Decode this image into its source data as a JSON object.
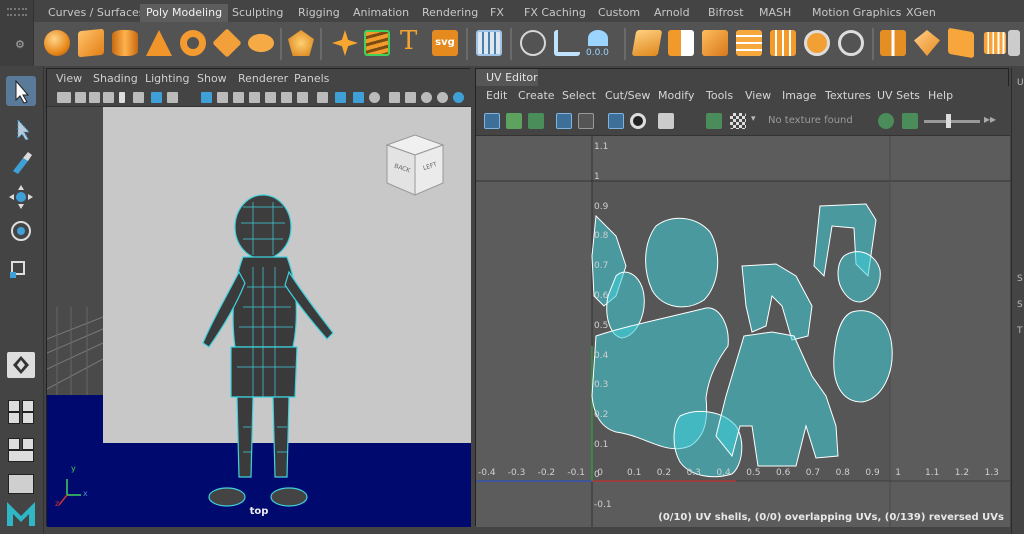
{
  "shelf_tabs": [
    "Curves / Surfaces",
    "Poly Modeling",
    "Sculpting",
    "Rigging",
    "Animation",
    "Rendering",
    "FX",
    "FX Caching",
    "Custom",
    "Arnold",
    "Bifrost",
    "MASH",
    "Motion Graphics",
    "XGen"
  ],
  "active_shelf_tab": "Poly Modeling",
  "shelf_icons": [
    "sphere-icon",
    "cube-icon",
    "cylinder-icon",
    "cone-icon",
    "torus-icon",
    "plane-icon",
    "disc-icon",
    "platonic-icon",
    "super-shape-icon",
    "sweep-mesh-icon",
    "type-icon",
    "svg-icon",
    "uv-editor-icon",
    "quad-draw-icon",
    "bevel-icon",
    "multi-cut-icon",
    "combine-icon",
    "separate-icon",
    "smooth-icon",
    "bridge-icon",
    "extrude-icon",
    "fill-hole-icon",
    "mirror-icon",
    "target-weld-icon",
    "merge-icon",
    "unfold-icon",
    "layout-uvs-icon",
    "planar-map-icon"
  ],
  "shelf_labels": {
    "type": "T",
    "svg": "svg",
    "num": "0.0.0"
  },
  "viewport": {
    "menu": [
      "View",
      "Shading",
      "Lighting",
      "Show",
      "Renderer",
      "Panels"
    ],
    "camera_label": "top",
    "viewcube": {
      "face1": "BACK",
      "face2": "LEFT"
    },
    "axes": {
      "x": "x",
      "y": "y",
      "z": "z"
    }
  },
  "uv_editor": {
    "title": "UV Editor",
    "menu": [
      "Edit",
      "Create",
      "Select",
      "Cut/Sew",
      "Modify",
      "Tools",
      "View",
      "Image",
      "Textures",
      "UV Sets",
      "Help"
    ],
    "texture_placeholder": "No texture found",
    "x_ticks": [
      "-0.4",
      "-0.3",
      "-0.2",
      "-0.1",
      "0",
      "0.1",
      "0.2",
      "0.3",
      "0.4",
      "0.5",
      "0.6",
      "0.7",
      "0.8",
      "0.9",
      "1",
      "1.1",
      "1.2",
      "1.3"
    ],
    "y_ticks": [
      "1.1",
      "1",
      "0.9",
      "0.8",
      "0.7",
      "0.6",
      "0.5",
      "0.4",
      "0.3",
      "0.2",
      "0.1",
      "0",
      "-0.1"
    ],
    "status": "(0/10) UV shells, (0/0) overlapping UVs, (0/139) reversed UVs"
  },
  "colors": {
    "wire": "#3fd1dd",
    "viewport_bg": "#c8c8c8",
    "floor": "#000a6e",
    "accent": "#5a7a9a"
  }
}
